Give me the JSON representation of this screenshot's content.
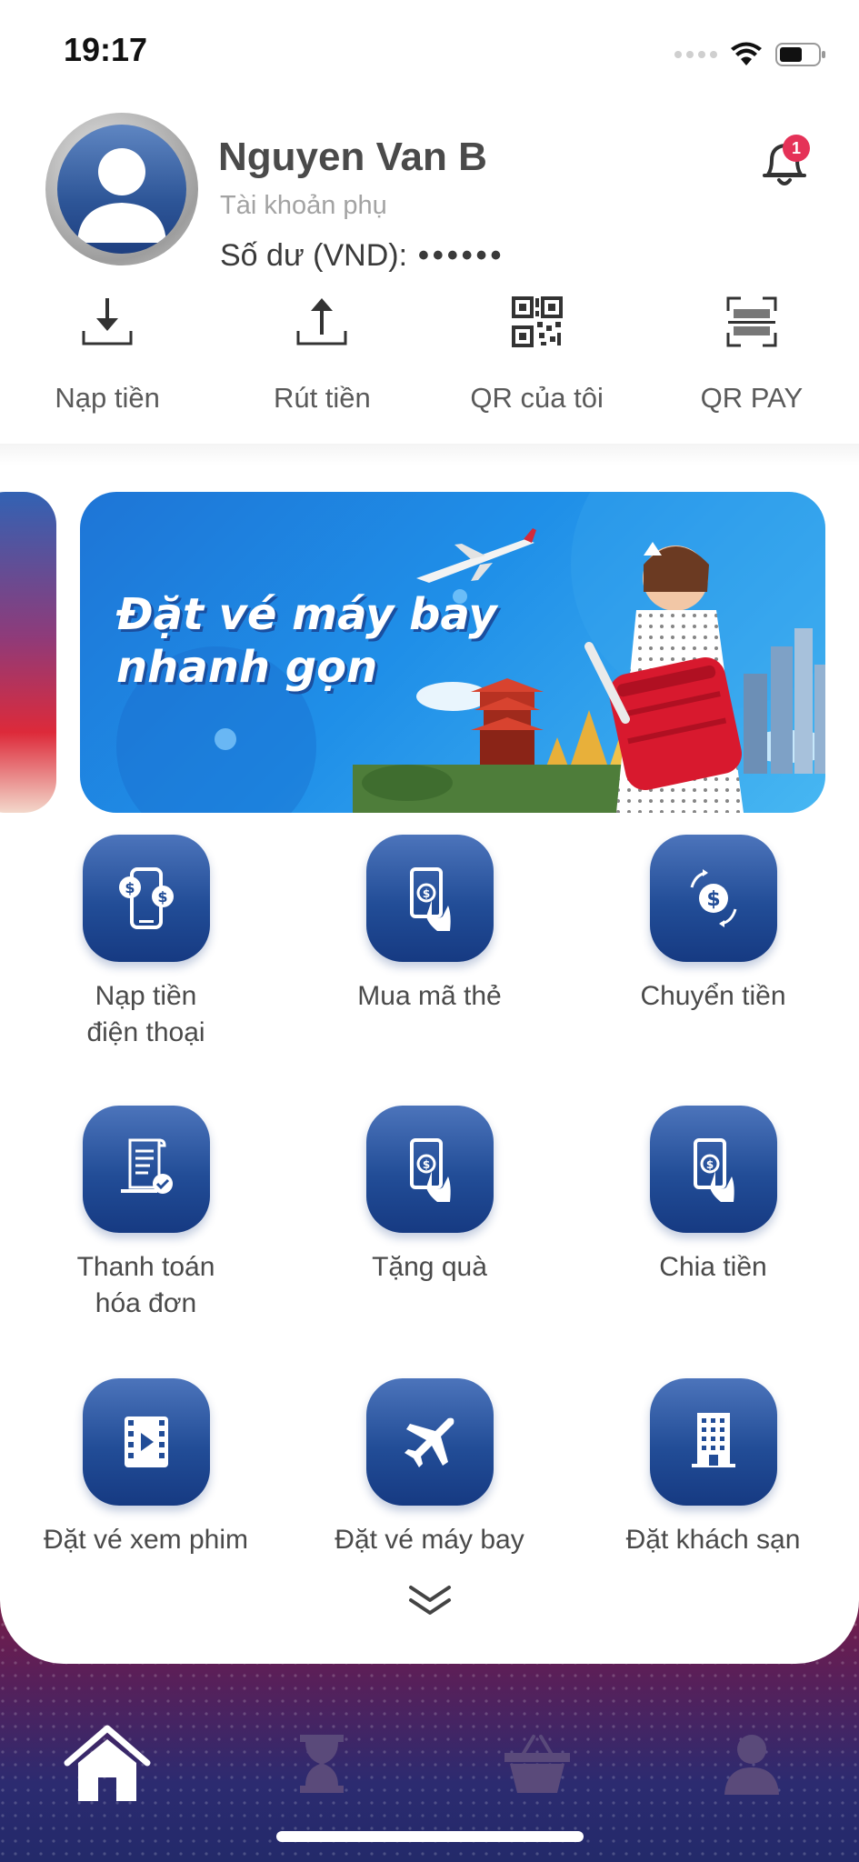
{
  "status_bar": {
    "time": "19:17"
  },
  "user": {
    "name": "Nguyen Van B",
    "account_type": "Tài khoản phụ",
    "balance_label": "Số dư (VND):",
    "balance_mask": "••••••"
  },
  "notifications": {
    "count": "1"
  },
  "quick_actions": [
    {
      "label": "Nạp tiền",
      "icon": "download-icon"
    },
    {
      "label": "Rút tiền",
      "icon": "upload-icon"
    },
    {
      "label": "QR của tôi",
      "icon": "qr-code-icon"
    },
    {
      "label": "QR PAY",
      "icon": "qr-scan-icon"
    }
  ],
  "banner": {
    "title_line1": "Đặt vé máy bay",
    "title_line2": "nhanh gọn"
  },
  "services": [
    {
      "label": "Nạp tiền\nđiện thoại",
      "icon": "phone-topup-icon"
    },
    {
      "label": "Mua mã thẻ",
      "icon": "card-code-icon"
    },
    {
      "label": "Chuyển tiền",
      "icon": "transfer-icon"
    },
    {
      "label": "Thanh toán\nhóa đơn",
      "icon": "bill-icon"
    },
    {
      "label": "Tặng quà",
      "icon": "gift-money-icon"
    },
    {
      "label": "Chia tiền",
      "icon": "split-money-icon"
    },
    {
      "label": "Đặt vé xem phim",
      "icon": "film-icon"
    },
    {
      "label": "Đặt vé máy bay",
      "icon": "airplane-icon"
    },
    {
      "label": "Đặt khách sạn",
      "icon": "hotel-icon"
    }
  ],
  "tabs": [
    {
      "name": "home",
      "icon": "home-icon",
      "active": true
    },
    {
      "name": "history",
      "icon": "hourglass-icon",
      "active": false
    },
    {
      "name": "shop",
      "icon": "basket-icon",
      "active": false
    },
    {
      "name": "profile",
      "icon": "person-icon",
      "active": false
    }
  ],
  "colors": {
    "primary": "#224d97",
    "badge": "#e53258",
    "text": "#4a4a4a"
  }
}
